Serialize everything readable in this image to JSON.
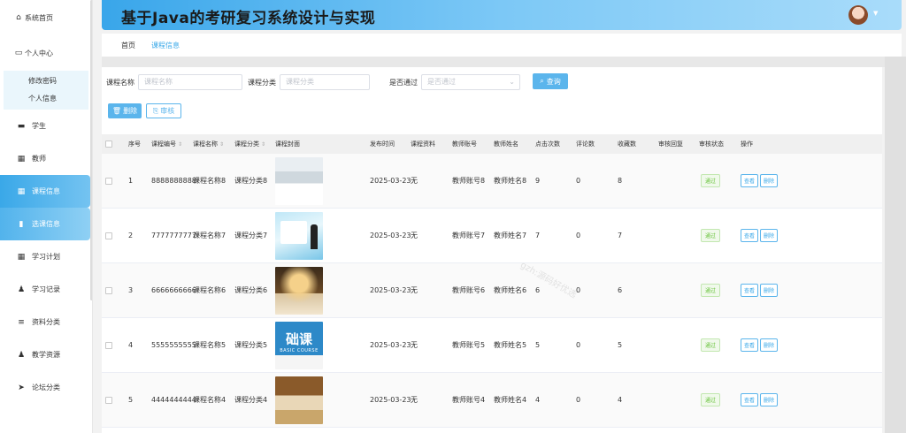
{
  "app": {
    "title": "基于Java的考研复习系统设计与实现"
  },
  "sidebar": {
    "home": "系统首页",
    "personal": "个人中心",
    "sub": [
      "修改密码",
      "个人信息"
    ],
    "items": [
      {
        "label": "学生",
        "icon": "briefcase-icon",
        "glyph": "▬"
      },
      {
        "label": "教师",
        "icon": "grid-icon",
        "glyph": "▦"
      },
      {
        "label": "课程信息",
        "icon": "grid-icon",
        "glyph": "▦"
      },
      {
        "label": "选课信息",
        "icon": "bar-chart-icon",
        "glyph": "▮"
      },
      {
        "label": "学习计划",
        "icon": "grid-icon",
        "glyph": "▦"
      },
      {
        "label": "学习记录",
        "icon": "user-icon",
        "glyph": "♟"
      },
      {
        "label": "资料分类",
        "icon": "list-icon",
        "glyph": "≡"
      },
      {
        "label": "教学资源",
        "icon": "user-icon",
        "glyph": "♟"
      },
      {
        "label": "论坛分类",
        "icon": "send-icon",
        "glyph": "➤"
      }
    ]
  },
  "breadcrumb": [
    "首页",
    "课程信息"
  ],
  "filters": {
    "name_label": "课程名称",
    "name_placeholder": "课程名称",
    "category_label": "课程分类",
    "category_placeholder": "课程分类",
    "pass_label": "是否通过",
    "pass_placeholder": "是否通过",
    "query": "查询"
  },
  "actions": {
    "delete": "删除",
    "audit": "审核"
  },
  "table": {
    "headers": [
      "序号",
      "课程编号",
      "课程名称",
      "课程分类",
      "课程封面",
      "发布时间",
      "课程资料",
      "教师账号",
      "教师姓名",
      "点击次数",
      "评论数",
      "收藏数",
      "审核回复",
      "审核状态",
      "操作"
    ],
    "row_buttons": {
      "view": "查看",
      "delete": "删除"
    },
    "rows": [
      {
        "no": "1",
        "code": "8888888888",
        "name": "课程名称8",
        "cat": "课程分类8",
        "date": "2025-03-23",
        "material": "无",
        "tacc": "教师账号8",
        "tname": "教师姓名8",
        "clicks": "9",
        "comments": "0",
        "favs": "8",
        "reply": "",
        "status": "通过"
      },
      {
        "no": "2",
        "code": "7777777777",
        "name": "课程名称7",
        "cat": "课程分类7",
        "date": "2025-03-23",
        "material": "无",
        "tacc": "教师账号7",
        "tname": "教师姓名7",
        "clicks": "7",
        "comments": "0",
        "favs": "7",
        "reply": "",
        "status": "通过"
      },
      {
        "no": "3",
        "code": "6666666666",
        "name": "课程名称6",
        "cat": "课程分类6",
        "date": "2025-03-23",
        "material": "无",
        "tacc": "教师账号6",
        "tname": "教师姓名6",
        "clicks": "6",
        "comments": "0",
        "favs": "6",
        "reply": "",
        "status": "通过"
      },
      {
        "no": "4",
        "code": "5555555555",
        "name": "课程名称5",
        "cat": "课程分类5",
        "date": "2025-03-23",
        "material": "无",
        "tacc": "教师账号5",
        "tname": "教师姓名5",
        "clicks": "5",
        "comments": "0",
        "favs": "5",
        "reply": "",
        "status": "通过"
      },
      {
        "no": "5",
        "code": "4444444444",
        "name": "课程名称4",
        "cat": "课程分类4",
        "date": "2025-03-23",
        "material": "无",
        "tacc": "教师账号4",
        "tname": "教师姓名4",
        "clicks": "4",
        "comments": "0",
        "favs": "4",
        "reply": "",
        "status": "通过"
      }
    ]
  },
  "thumb4_text": {
    "big": "础课",
    "small": "BASIC COURSE"
  },
  "watermark": "gzh:源码好优选",
  "colors": {
    "accent": "#3aa8e8",
    "status_green": "#67c23a"
  }
}
